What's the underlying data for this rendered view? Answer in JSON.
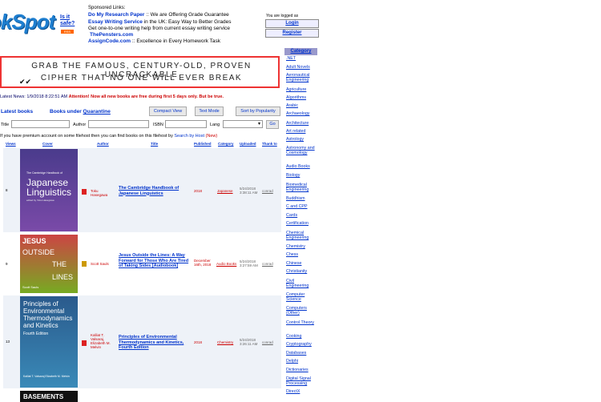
{
  "header": {
    "logo_text": "okSpot",
    "is_it_safe": "Is it safe?",
    "rss": "RSS",
    "sponsored_label": "Sponsored Links:",
    "sponsored": [
      {
        "link": "Do My Research Paper",
        "desc": " :: We are Offering Grade Guarantee"
      },
      {
        "link": "Essay Writing Service",
        "desc": " in the UK: Easy Way to Better Grades"
      },
      {
        "link": "",
        "desc": "Get one-to-one writing help from current essay writing service"
      },
      {
        "link": "ThePensters.com",
        "desc": ""
      },
      {
        "link": "AssignCode.com",
        "desc": " :: Excellence in Every Homework Task"
      }
    ],
    "logged_status": "You are logged as",
    "login": "Login",
    "register": "Register"
  },
  "banner": {
    "line1": "GRAB THE FAMOUS, CENTURY-OLD, PROVEN UNCRACKABLE",
    "line2": "CIPHER THAT NO ONE WILL EVER BREAK"
  },
  "news": {
    "date": "Latest News: 1/9/2018 8:22:51 AM",
    "message": "Attention! Now all new books are free during first 5 days only. But be true."
  },
  "nav": {
    "latest_books": "Latest books",
    "books_under": "Books under",
    "quarantine": "Quarantine",
    "compact_view": "Compact View",
    "text_mode": "Text Mode",
    "sort_popularity": "Sort by Popularity"
  },
  "search": {
    "title_label": "Title",
    "author_label": "Author",
    "isbn_label": "ISBN",
    "lang_label": "Lang",
    "go": "Go"
  },
  "premium": {
    "text": "If you have premium account on some filehost then you can find books on this filehost by",
    "link": "Search by Host",
    "new": "(New)"
  },
  "table": {
    "headers": [
      "Views",
      "Cover",
      "Author",
      "Title",
      "Published",
      "Category",
      "Uploaded",
      "Thank to"
    ],
    "rows": [
      {
        "views": "8",
        "author": "Toku Hasegawa",
        "title": "The Cambridge Handbook of Japanese Linguistics",
        "published": "2018",
        "category": "Japanese",
        "uploaded": "5/24/2018 3:38:11 AM",
        "thank": "conrad",
        "cover_title": "Japanese Linguistics",
        "cover_top": "The Cambridge Handbook of",
        "cover_editor": "edited by Yoko Hasegawa"
      },
      {
        "views": "9",
        "author": "Scott Sauls",
        "title": "Jesus Outside the Lines: A Way Forward for Those Who Are Tired of Taking Sides [Audiobook]",
        "published": "December 16th, 2018",
        "category": "Audio Books",
        "uploaded": "5/24/2018 3:27:59 AM",
        "thank": "conrad",
        "cover_l1": "JESUS",
        "cover_l2": "OUTSIDE",
        "cover_l3": "THE",
        "cover_l4": "LINES",
        "cover_author": "Scott Sauls"
      },
      {
        "views": "13",
        "author": "Kalliat T. Valsaraj, Elizabeth M. Melvin",
        "title": "Principles of Environmental Thermodynamics and Kinetics, Fourth Edition",
        "published": "2018",
        "category": "Chemistry",
        "uploaded": "5/24/2018 3:26:11 AM",
        "thank": "conrad",
        "cover_title": "Principles of Environmental Thermodynamics and Kinetics",
        "cover_edition": "Fourth Edition",
        "cover_authors": "Kalliat T. Valsaraj Elizabeth M. Melvin"
      }
    ],
    "partial_cover": "BASEMENTS"
  },
  "sidebar": {
    "header": "Category",
    "items": [
      ".NET",
      "Adult Novels",
      "Aeronautical Engineering",
      "Agriculture",
      "Algorithms",
      "Arabic",
      "Archaeology",
      "Architecture",
      "Art related",
      "Astrology",
      "Astronomy and Cosmology",
      "Audio Books",
      "Biology",
      "Biomedical Engineering",
      "Buddhism",
      "C and CPP",
      "Cards",
      "Certification",
      "Chemical Engineering",
      "Chemistry",
      "Chess",
      "Chinese",
      "Christianity",
      "Civil Engineering",
      "Computer Science",
      "Computers (Other)",
      "Control Theory",
      "Cooking",
      "Cryptography",
      "Databases",
      "Delphi",
      "Dictionaries",
      "Digital Signal Processing",
      "DirectX"
    ]
  },
  "colors": {
    "accent": "#0033cc",
    "sidebar_header": "#9999cc",
    "row_bg": "#eef2f8"
  }
}
